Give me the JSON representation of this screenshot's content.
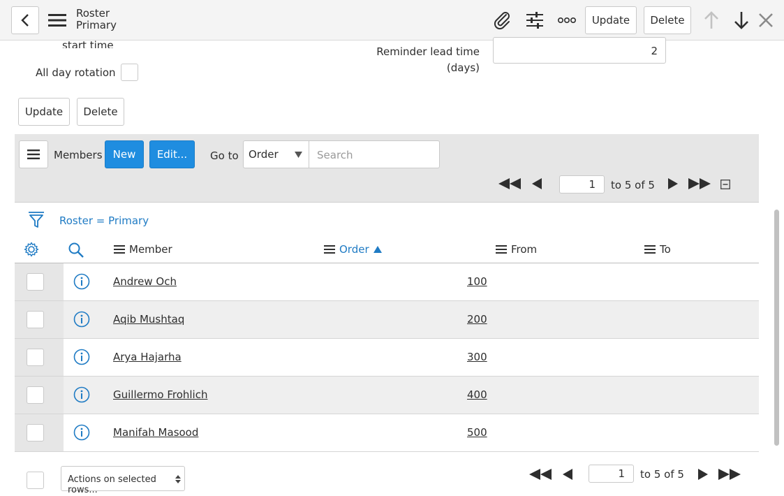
{
  "header": {
    "title_line1": "Roster",
    "title_line2": "Primary",
    "update_label": "Update",
    "delete_label": "Delete"
  },
  "form": {
    "cut_label": "start time",
    "all_day_label": "All day rotation",
    "reminder_label_line1": "Reminder lead time",
    "reminder_label_line2": "(days)",
    "reminder_value": "2",
    "update_label": "Update",
    "delete_label": "Delete"
  },
  "related_list": {
    "title": "Members",
    "new_label": "New",
    "edit_label": "Edit...",
    "goto_label": "Go to",
    "goto_selected": "Order",
    "search_placeholder": "Search",
    "filter_text": "Roster = Primary"
  },
  "pager": {
    "page": "1",
    "range_text": "to 5 of 5"
  },
  "columns": {
    "member": "Member",
    "order": "Order",
    "from": "From",
    "to": "To"
  },
  "rows": [
    {
      "member": "Andrew Och",
      "order": "100"
    },
    {
      "member": "Aqib Mushtaq",
      "order": "200"
    },
    {
      "member": "Arya Hajarha",
      "order": "300"
    },
    {
      "member": "Guillermo Frohlich",
      "order": "400"
    },
    {
      "member": "Manifah Masood",
      "order": "500"
    }
  ],
  "footer": {
    "actions_label": "Actions on selected rows...",
    "page": "1",
    "range_text": "to 5 of 5"
  },
  "colors": {
    "accent": "#1f8de0",
    "link": "#1f7bc4",
    "header_bg": "#f4f4f4",
    "list_bar_bg": "#e6e6e6"
  }
}
